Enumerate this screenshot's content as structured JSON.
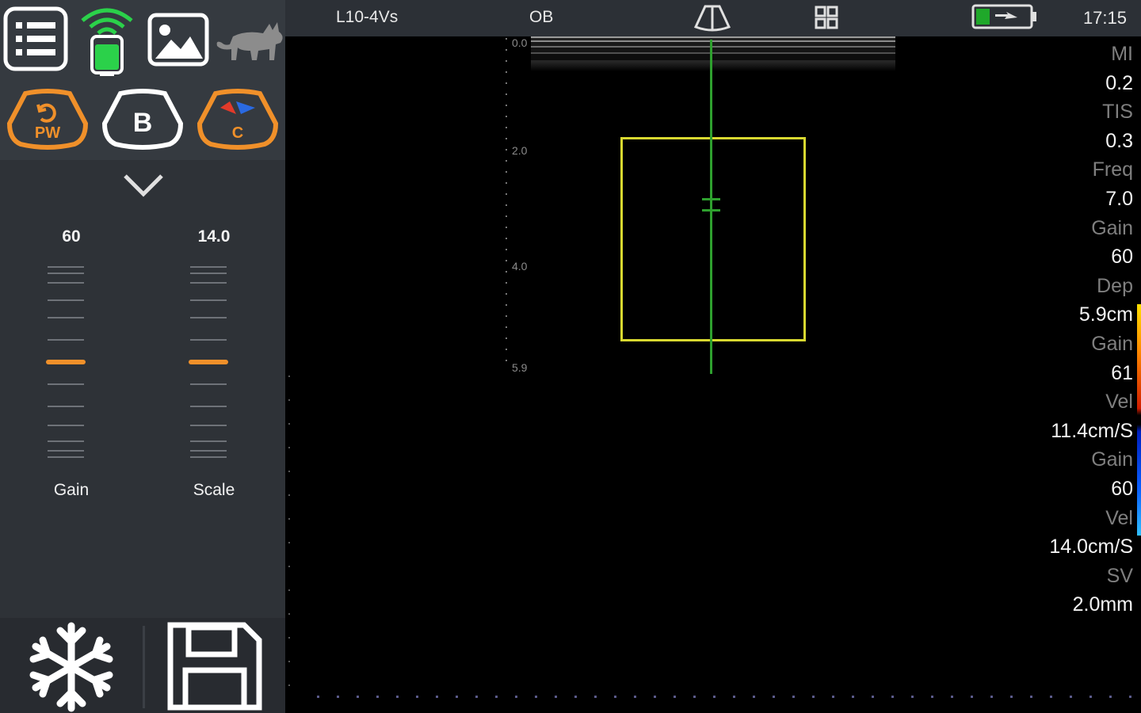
{
  "topbar": {
    "probe": "L10-4Vs",
    "preset": "OB",
    "time": "17:15",
    "icons": [
      "sector-view-icon",
      "layout-grid-icon",
      "battery-charging-icon"
    ]
  },
  "left_panel": {
    "top_icons": [
      "menu-list-icon",
      "wireless-probe-icon",
      "image-gallery-icon",
      "cat-icon"
    ],
    "modes": [
      {
        "label": "PW",
        "active": true
      },
      {
        "label": "B",
        "active": false
      },
      {
        "label": "C",
        "active": true
      }
    ],
    "sliders": [
      {
        "label": "Gain",
        "value": "60"
      },
      {
        "label": "Scale",
        "value": "14.0"
      }
    ],
    "bottom_buttons": [
      "freeze-icon",
      "save-icon"
    ]
  },
  "image": {
    "depth_labels": [
      "0.0",
      "2.0",
      "4.0",
      "5.9"
    ]
  },
  "params": [
    {
      "name": "MI",
      "value": "0.2"
    },
    {
      "name": "TIS",
      "value": "0.3"
    },
    {
      "name": "Freq",
      "value": "7.0"
    },
    {
      "name": "Gain",
      "value": "60"
    },
    {
      "name": "Dep",
      "value": "5.9cm"
    },
    {
      "name": "Gain",
      "value": "61"
    },
    {
      "name": "Vel",
      "value": "11.4cm/S"
    },
    {
      "name": "Gain",
      "value": "60"
    },
    {
      "name": "Vel",
      "value": "14.0cm/S"
    },
    {
      "name": "SV",
      "value": "2.0mm"
    }
  ],
  "colors": {
    "accent": "#f0902a",
    "roi_box": "#d8d830",
    "cursor_line": "#2ea02e",
    "panel_bg": "#2f3338"
  }
}
